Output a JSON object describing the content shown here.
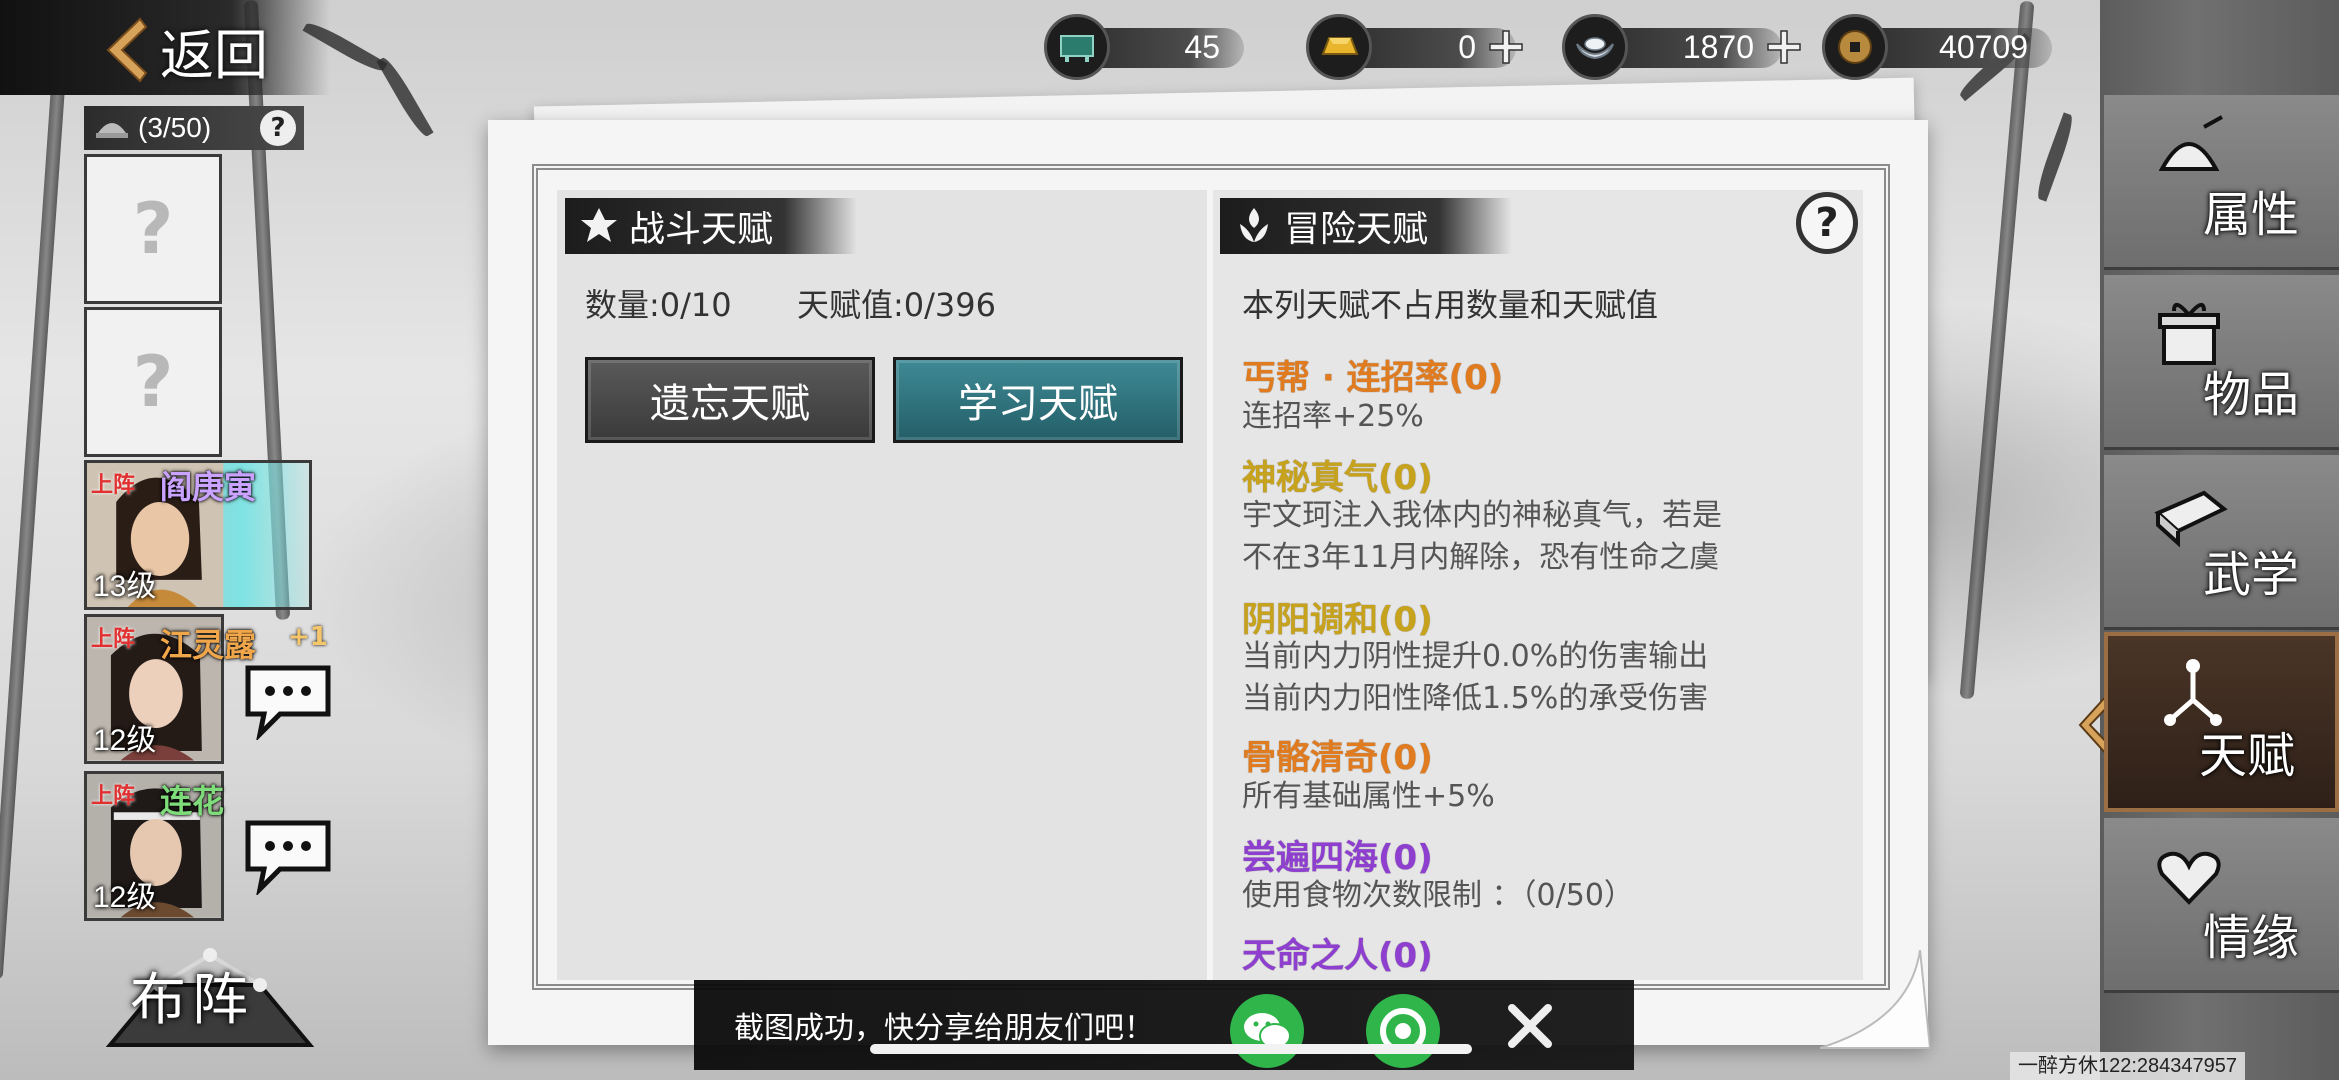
{
  "top_bar": {
    "back_label": "返回",
    "resources": [
      {
        "icon": "ticket-icon",
        "value": "45",
        "has_plus": false
      },
      {
        "icon": "gold-bar-icon",
        "value": "0",
        "has_plus": true
      },
      {
        "icon": "silver-ingot-icon",
        "value": "1870",
        "has_plus": true
      },
      {
        "icon": "copper-coin-icon",
        "value": "40709",
        "has_plus": false
      }
    ]
  },
  "roster": {
    "count": "(3/50)",
    "empty_slot_symbol": "?",
    "heroes": [
      {
        "tag": "上阵",
        "name": "阎庚寅",
        "level": "13级",
        "name_color": "#c9a3ff",
        "plus": ""
      },
      {
        "tag": "上阵",
        "name": "江灵露",
        "level": "12级",
        "name_color": "#f0a64a",
        "plus": "+1"
      },
      {
        "tag": "上阵",
        "name": "连花",
        "level": "12级",
        "name_color": "#7fdc7a",
        "plus": ""
      }
    ],
    "formation_label": "布阵"
  },
  "combat_talent": {
    "title": "战斗天赋",
    "count_text": "数量:0/10",
    "value_text": "天赋值:0/396",
    "forget_label": "遗忘天赋",
    "learn_label": "学习天赋"
  },
  "adventure_talent": {
    "title": "冒险天赋",
    "note": "本列天赋不占用数量和天赋值",
    "help": "?",
    "items": [
      {
        "name": "丐帮 · 连招率(0)",
        "color": "#e07b1f",
        "desc": [
          "连招率+25%"
        ]
      },
      {
        "name": "神秘真气(0)",
        "color": "#c7a21d",
        "desc": [
          "宇文珂注入我体内的神秘真气，若是",
          "不在3年11月内解除，恐有性命之虞"
        ]
      },
      {
        "name": "阴阳调和(0)",
        "color": "#c7a21d",
        "desc": [
          "当前内力阴性提升0.0%的伤害输出",
          "当前内力阳性降低1.5%的承受伤害"
        ]
      },
      {
        "name": "骨骼清奇(0)",
        "color": "#e07b1f",
        "desc": [
          "所有基础属性+5%"
        ]
      },
      {
        "name": "尝遍四海(0)",
        "color": "#8e3fd0",
        "desc": [
          "使用食物次数限制 ：（0/50）"
        ]
      },
      {
        "name": "天命之人(0)",
        "color": "#8e3fd0",
        "desc": []
      }
    ]
  },
  "side_tabs": [
    {
      "label": "属性",
      "icon": "helmet-icon",
      "active": false
    },
    {
      "label": "物品",
      "icon": "gift-box-icon",
      "active": false
    },
    {
      "label": "武学",
      "icon": "scroll-book-icon",
      "active": false
    },
    {
      "label": "天赋",
      "icon": "talent-tree-icon",
      "active": true
    },
    {
      "label": "情缘",
      "icon": "heart-knot-icon",
      "active": false
    }
  ],
  "toast": {
    "text": "截图成功，快分享给朋友们吧！",
    "share_targets": [
      "wechat-icon",
      "moments-icon"
    ]
  },
  "watermark": "一醉方休122:284347957"
}
